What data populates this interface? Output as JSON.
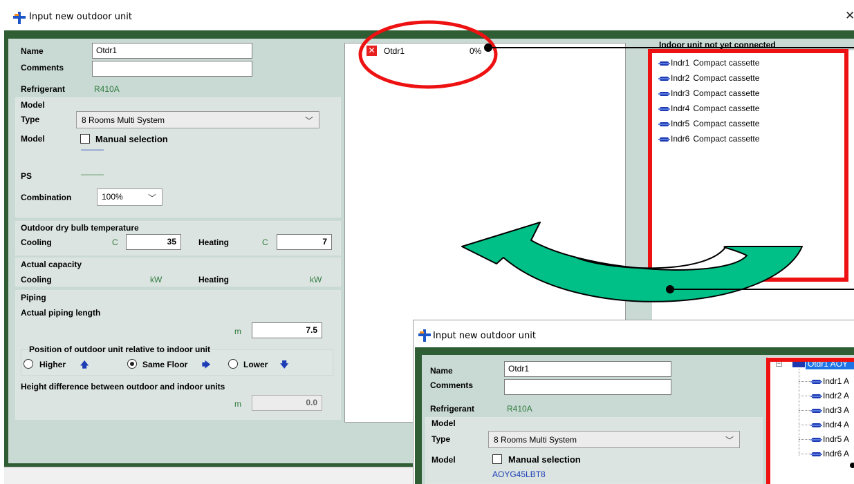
{
  "window": {
    "title": "Input new outdoor unit",
    "close_glyph": "✕"
  },
  "form": {
    "name_label": "Name",
    "name_value": "Otdr1",
    "comments_label": "Comments",
    "comments_value": "",
    "refrigerant_label": "Refrigerant",
    "refrigerant_value": "R410A",
    "model_group": "Model",
    "type_label": "Type",
    "type_value": "8 Rooms Multi System",
    "model_label": "Model",
    "manual_selection": "Manual selection",
    "model_value": "———",
    "ps_label": "PS",
    "ps_value": "———",
    "combination_label": "Combination",
    "combination_value": "100%",
    "outdoor_temp_group": "Outdoor dry bulb temperature",
    "cooling_label": "Cooling",
    "heating_label": "Heating",
    "temp_unit": "C",
    "cooling_temp": "35",
    "heating_temp": "7",
    "actual_capacity_group": "Actual capacity",
    "capacity_unit": "kW",
    "piping_group": "Piping",
    "actual_piping_length_label": "Actual piping length",
    "length_unit": "m",
    "piping_length": "7.5",
    "position_group": "Position of outdoor unit relative to indoor unit",
    "position_higher": "Higher",
    "position_same": "Same Floor",
    "position_lower": "Lower",
    "position_selected": "Same Floor",
    "height_diff_label": "Height difference between outdoor and indoor units",
    "height_diff_value": "0.0"
  },
  "tree": {
    "outdoor_node": "Otdr1",
    "outdoor_percent": "0%"
  },
  "indoor_list": {
    "title": "Indoor unit not yet connected",
    "items": [
      {
        "id": "Indr1",
        "type": "Compact cassette"
      },
      {
        "id": "Indr2",
        "type": "Compact cassette"
      },
      {
        "id": "Indr3",
        "type": "Compact cassette"
      },
      {
        "id": "Indr4",
        "type": "Compact cassette"
      },
      {
        "id": "Indr5",
        "type": "Compact cassette"
      },
      {
        "id": "Indr6",
        "type": "Compact cassette"
      }
    ]
  },
  "inset": {
    "title": "Input new outdoor unit",
    "name_label": "Name",
    "name_value": "Otdr1",
    "comments_label": "Comments",
    "comments_value": "",
    "refrigerant_label": "Refrigerant",
    "refrigerant_value": "R410A",
    "model_group": "Model",
    "type_label": "Type",
    "type_value": "8 Rooms Multi System",
    "model_label": "Model",
    "manual_selection": "Manual selection",
    "model_value": "AOYG45LBT8",
    "tree_root": "Otdr1  AOY",
    "tree_children": [
      "Indr1  A",
      "Indr2  A",
      "Indr3  A",
      "Indr4  A",
      "Indr5  A",
      "Indr6  A"
    ]
  },
  "colors": {
    "frame_green": "#2f5d34",
    "panel_bg": "#c9dad4",
    "highlight_red": "#ee1111",
    "arrow_green": "#00c087",
    "refrigerant_text": "#2f7a3d",
    "selection_blue": "#1e74e6"
  }
}
